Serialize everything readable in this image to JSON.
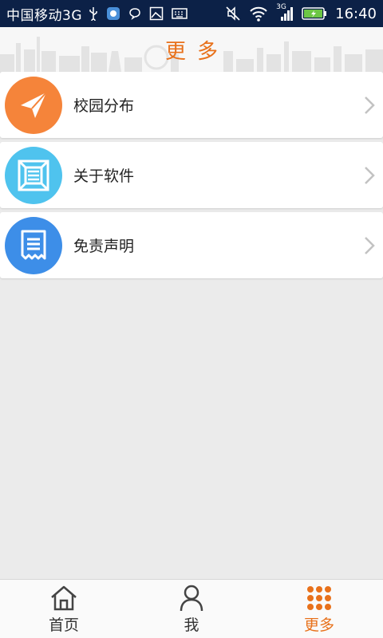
{
  "status_bar": {
    "carrier": "中国移动3G",
    "network_badge": "3G",
    "time": "16:40"
  },
  "header": {
    "title": "更多"
  },
  "menu": {
    "items": [
      {
        "label": "校园分布",
        "icon": "paper-plane-icon",
        "color": "#f5843a"
      },
      {
        "label": "关于软件",
        "icon": "frame-icon",
        "color": "#4fc3ee"
      },
      {
        "label": "免责声明",
        "icon": "document-icon",
        "color": "#3d8ee8"
      }
    ]
  },
  "tabbar": {
    "tabs": [
      {
        "label": "首页",
        "icon": "home-icon"
      },
      {
        "label": "我",
        "icon": "person-icon"
      },
      {
        "label": "更多",
        "icon": "grid-dots-icon",
        "active": true
      }
    ],
    "accent": "#e8711b"
  }
}
